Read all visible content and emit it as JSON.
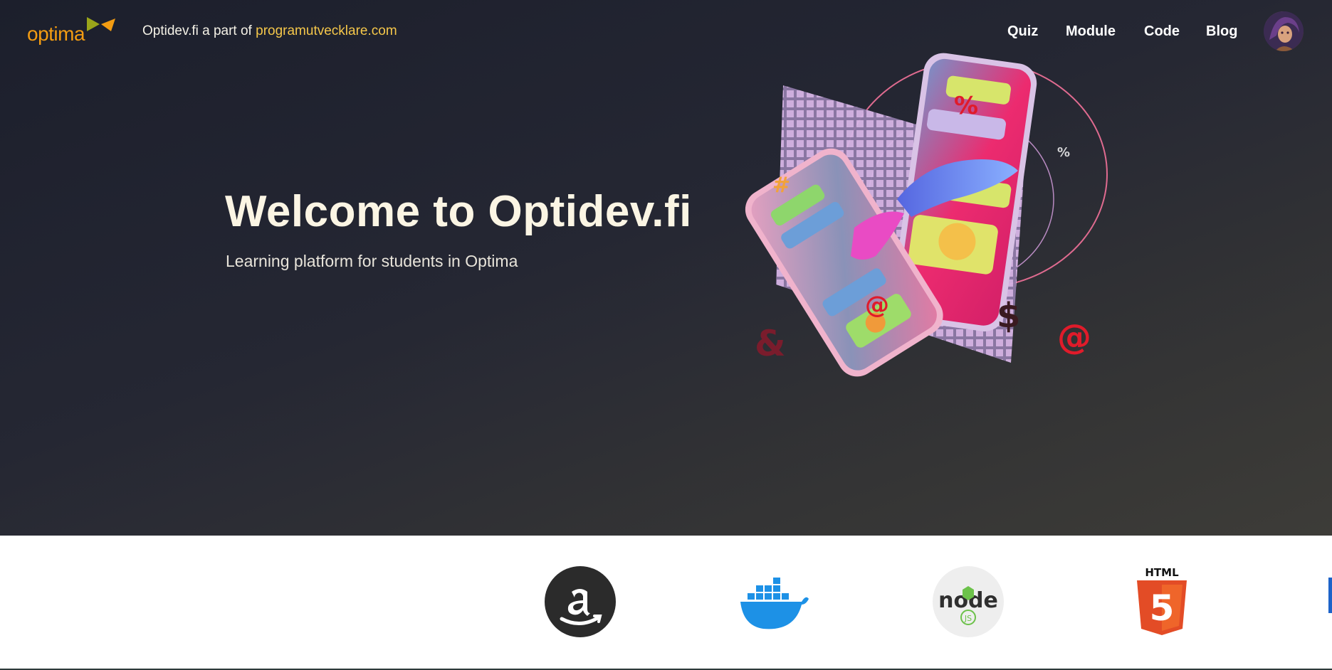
{
  "header": {
    "logo_text": "optima",
    "tagline_prefix": "Optidev.fi a part of",
    "tagline_link": "programutvecklare.com",
    "nav": [
      {
        "label": "Quiz"
      },
      {
        "label": "Module"
      },
      {
        "label": "Code"
      },
      {
        "label": "Blog"
      }
    ]
  },
  "hero": {
    "title": "Welcome to Optidev.fi",
    "subtitle": "Learning platform for students in Optima",
    "art_glyphs": [
      "%",
      "@",
      "&",
      "$",
      "#",
      "%"
    ]
  },
  "tech_logos": [
    {
      "name": "amazon-icon"
    },
    {
      "name": "docker-icon"
    },
    {
      "name": "nodejs-icon",
      "caption": "JS"
    },
    {
      "name": "html5-icon",
      "caption": "HTML",
      "digit": "5"
    }
  ],
  "colors": {
    "accent_link": "#f5c74a",
    "logo_orange": "#f39c12",
    "logo_olive": "#9aa51a"
  }
}
